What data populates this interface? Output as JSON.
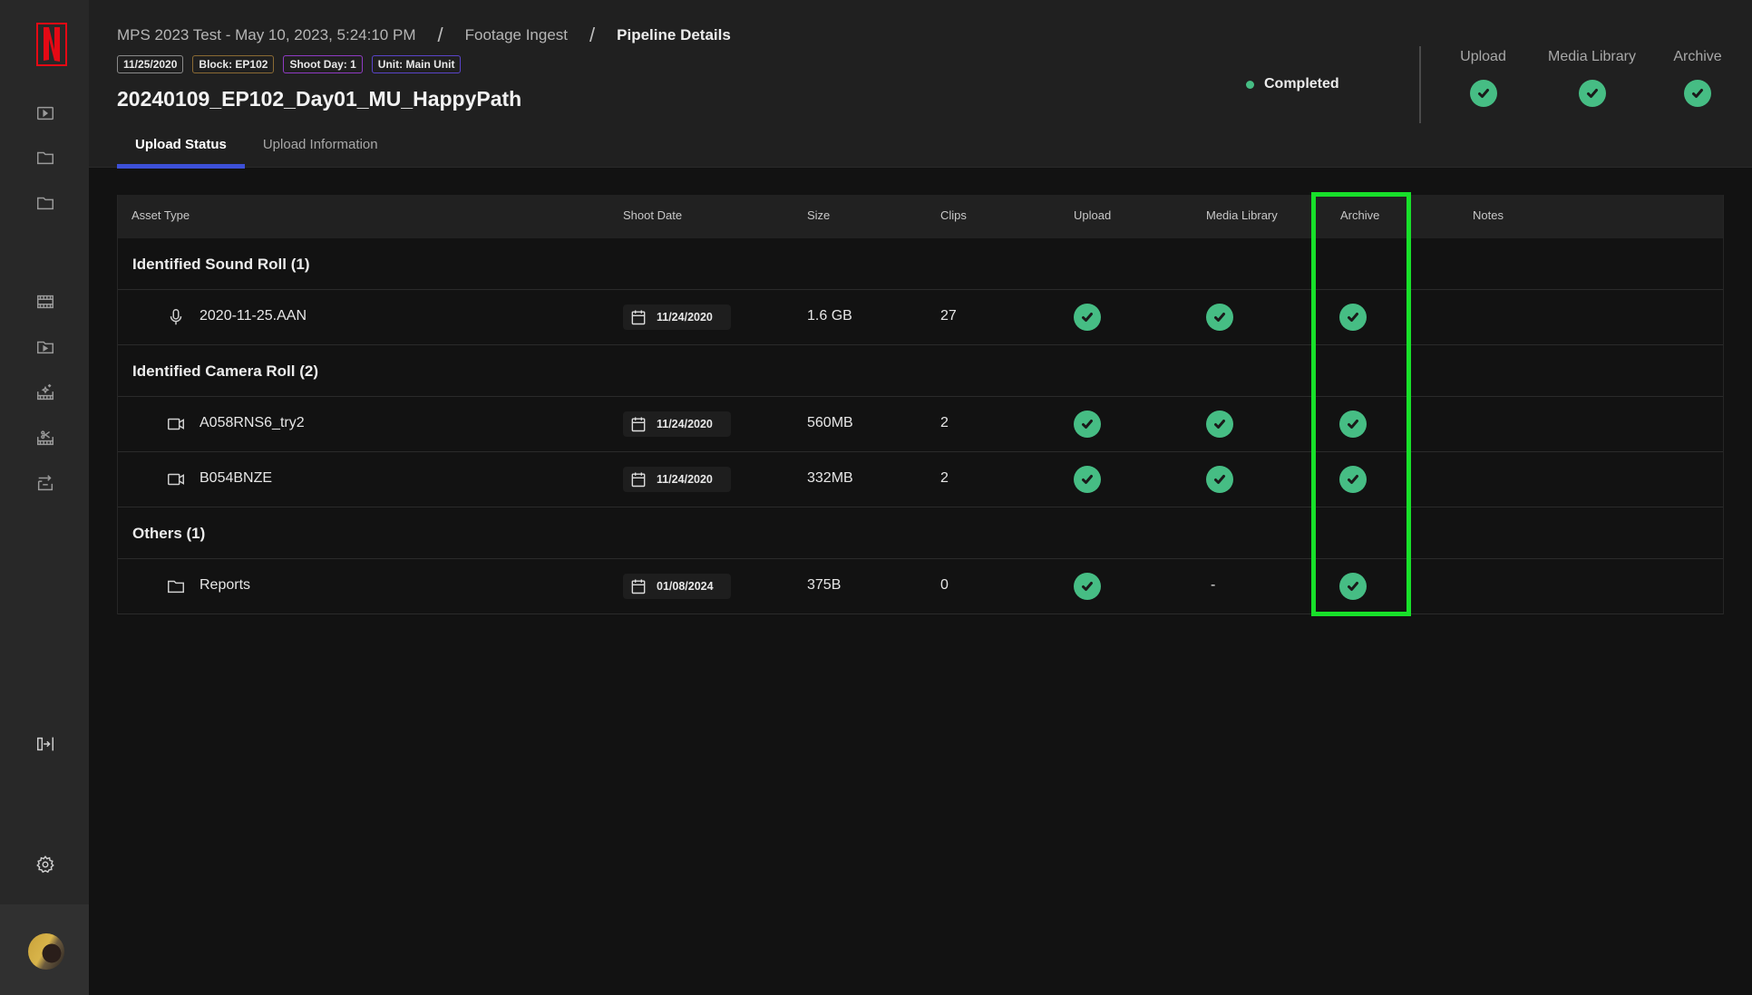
{
  "app": {
    "brand": "N",
    "brand_color": "#e50914"
  },
  "sidebar": {
    "items": [
      {
        "icon": "video-library-icon"
      },
      {
        "icon": "folder-icon"
      },
      {
        "icon": "folder-icon"
      },
      {
        "icon": "film-strip-icon"
      },
      {
        "icon": "folder-play-icon"
      },
      {
        "icon": "film-sparkle-icon"
      },
      {
        "icon": "film-cut-icon"
      },
      {
        "icon": "archive-export-icon"
      }
    ],
    "collapse_icon": "expand-sidebar-icon",
    "settings_icon": "gear-icon",
    "avatar": "user-avatar"
  },
  "header": {
    "breadcrumb": [
      "MPS 2023 Test - May 10, 2023, 5:24:10 PM",
      "Footage Ingest",
      "Pipeline Details"
    ],
    "breadcrumb_sep": "/",
    "chips": [
      "11/25/2020",
      "Block: EP102",
      "Shoot Day: 1",
      "Unit: Main Unit"
    ],
    "title": "20240109_EP102_Day01_MU_HappyPath",
    "tabs": [
      {
        "label": "Upload Status",
        "active": true
      },
      {
        "label": "Upload Information",
        "active": false
      }
    ],
    "status": {
      "label": "Completed",
      "color": "#46bd84"
    },
    "summary": [
      {
        "label": "Upload",
        "state": "complete"
      },
      {
        "label": "Media Library",
        "state": "complete"
      },
      {
        "label": "Archive",
        "state": "complete"
      }
    ]
  },
  "table": {
    "columns": [
      "Asset Type",
      "Shoot Date",
      "Size",
      "Clips",
      "Upload",
      "Media Library",
      "Archive",
      "Notes"
    ],
    "groups": [
      {
        "label": "Identified Sound Roll (1)",
        "rows": [
          {
            "icon": "microphone-icon",
            "name": "2020-11-25.AAN",
            "shoot_date": "11/24/2020",
            "size": "1.6 GB",
            "clips": "27",
            "upload": "complete",
            "media_library": "complete",
            "archive": "complete",
            "notes": ""
          }
        ]
      },
      {
        "label": "Identified Camera Roll (2)",
        "rows": [
          {
            "icon": "video-camera-icon",
            "name": "A058RNS6_try2",
            "shoot_date": "11/24/2020",
            "size": "560MB",
            "clips": "2",
            "upload": "complete",
            "media_library": "complete",
            "archive": "complete",
            "notes": ""
          },
          {
            "icon": "video-camera-icon",
            "name": "B054BNZE",
            "shoot_date": "11/24/2020",
            "size": "332MB",
            "clips": "2",
            "upload": "complete",
            "media_library": "complete",
            "archive": "complete",
            "notes": ""
          }
        ]
      },
      {
        "label": "Others (1)",
        "rows": [
          {
            "icon": "folder-icon",
            "name": "Reports",
            "shoot_date": "01/08/2024",
            "size": "375B",
            "clips": "0",
            "upload": "complete",
            "media_library": "-",
            "archive": "complete",
            "notes": ""
          }
        ]
      }
    ],
    "highlighted_column": "Archive",
    "highlight_color": "#18e02a",
    "check_color": "#46bd84"
  }
}
